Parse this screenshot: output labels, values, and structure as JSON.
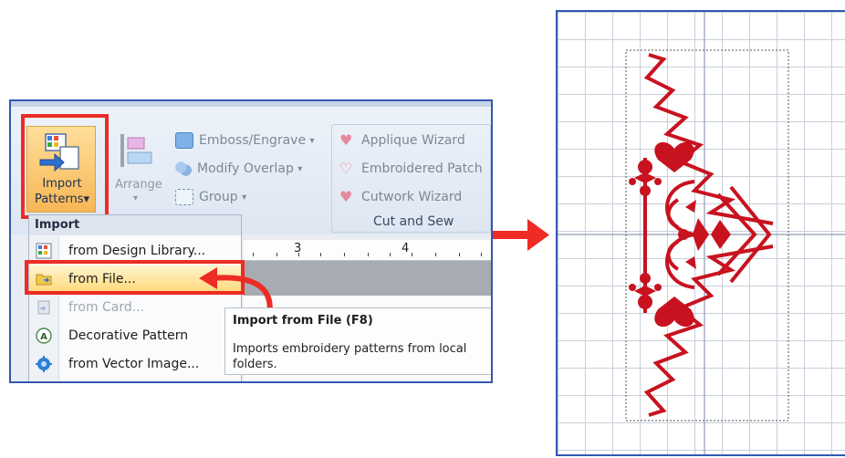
{
  "ribbon": {
    "import_patterns_label_1": "Import",
    "import_patterns_label_2": "Patterns",
    "arrange_label": "Arrange",
    "emboss_engrave_label": "Emboss/Engrave",
    "modify_overlap_label": "Modify Overlap",
    "group_label": "Group",
    "applique_wizard_label": "Applique Wizard",
    "embroidered_patch_label": "Embroidered Patch",
    "cutwork_wizard_label": "Cutwork Wizard",
    "cut_and_sew_group": "Cut and Sew",
    "dropdown_glyph": "▾"
  },
  "ruler": {
    "mark_3": "3",
    "mark_4": "4"
  },
  "import_menu": {
    "header": "Import",
    "items": [
      {
        "label": "from Design Library...",
        "enabled": true
      },
      {
        "label": "from File...",
        "enabled": true,
        "highlighted": true
      },
      {
        "label": "from Card...",
        "enabled": false
      },
      {
        "label": "Decorative Pattern",
        "enabled": true
      },
      {
        "label": "from Vector Image...",
        "enabled": true
      }
    ]
  },
  "tooltip": {
    "title": "Import from File (F8)",
    "description": "Imports embroidery patterns from local folders."
  },
  "colors": {
    "highlight_red": "#ee2b24",
    "embroidery_red": "#c8121f",
    "panel_border": "#3457b0"
  }
}
